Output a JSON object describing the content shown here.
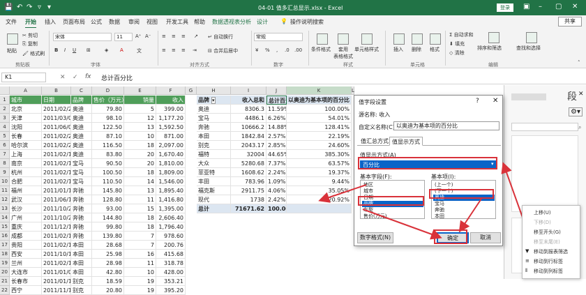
{
  "title": "04-01 值多汇总显示.xlsx - Excel",
  "login_label": "登录",
  "share_label": "共享",
  "window_buttons": [
    "–",
    "▢",
    "✕"
  ],
  "ribbon_tabs": [
    "文件",
    "开始",
    "插入",
    "页面布局",
    "公式",
    "数据",
    "审阅",
    "视图",
    "开发工具",
    "帮助",
    "数据透视表分析",
    "设计",
    "操作说明搜索"
  ],
  "ribbon": {
    "paste": "粘贴",
    "cut": "剪切",
    "copy": "复制",
    "format_painter": "格式刷",
    "font_name": "宋体",
    "font_size": "11",
    "wrap_text": "自动换行",
    "merge_center": "合并后居中",
    "number_format": "常规",
    "cond_format": "条件格式",
    "format_as_table": "套用\n表格格式",
    "cell_styles": "单元格样式",
    "insert": "插入",
    "delete": "删除",
    "format": "格式",
    "autosum": "自动求和",
    "fill": "填充",
    "clear": "清除",
    "sort_filter": "排序和筛选",
    "find_select": "查找和选择",
    "groups": [
      "剪贴板",
      "字体",
      "对齐方式",
      "数字",
      "样式",
      "单元格",
      "编辑"
    ]
  },
  "formula_bar": {
    "name_box": "K1",
    "content": "总计百分比"
  },
  "columns": [
    "A",
    "B",
    "C",
    "D",
    "E",
    "F",
    "G",
    "H",
    "I",
    "J",
    "K",
    "L"
  ],
  "headers": [
    "城市",
    "日期",
    "品牌",
    "售价（万元）",
    "销量",
    "收入"
  ],
  "rows": [
    [
      "北京",
      "2011/02/23",
      "奥迪",
      "79.80",
      "5",
      "399.00"
    ],
    [
      "天津",
      "2011/03/04",
      "奥迪",
      "98.10",
      "12",
      "1,177.20"
    ],
    [
      "沈阳",
      "2011/06/09",
      "奥迪",
      "122.50",
      "13",
      "1,592.50"
    ],
    [
      "长春",
      "2011/02/23",
      "奥迪",
      "87.10",
      "10",
      "871.00"
    ],
    [
      "哈尔滨",
      "2011/02/24",
      "奥迪",
      "116.50",
      "18",
      "2,097.00"
    ],
    [
      "上海",
      "2011/02/10",
      "奥迪",
      "83.80",
      "20",
      "1,670.40"
    ],
    [
      "南京",
      "2011/02/13",
      "宝马",
      "90.50",
      "20",
      "1,810.00"
    ],
    [
      "杭州",
      "2011/02/15",
      "宝马",
      "100.50",
      "18",
      "1,809.00"
    ],
    [
      "合肥",
      "2011/02/12",
      "宝马",
      "110.50",
      "14",
      "1,546.00"
    ],
    [
      "福州",
      "2011/01/13",
      "奔驰",
      "145.80",
      "13",
      "1,895.40"
    ],
    [
      "武汉",
      "2011/06/10",
      "奔驰",
      "128.80",
      "11",
      "1,416.80"
    ],
    [
      "长沙",
      "2011/10/26",
      "奔驰",
      "93.00",
      "15",
      "1,395.00"
    ],
    [
      "广州",
      "2011/10/26",
      "奔驰",
      "144.80",
      "18",
      "2,606.40"
    ],
    [
      "重庆",
      "2011/12/15",
      "奔驰",
      "99.80",
      "18",
      "1,796.40"
    ],
    [
      "成都",
      "2011/02/19",
      "奔驰",
      "139.80",
      "7",
      "978.60"
    ],
    [
      "贵阳",
      "2011/02/19",
      "本田",
      "28.68",
      "7",
      "200.76"
    ],
    [
      "西安",
      "2011/10/10",
      "本田",
      "25.98",
      "16",
      "415.68"
    ],
    [
      "兰州",
      "2011/02/15",
      "本田",
      "28.98",
      "11",
      "318.78"
    ],
    [
      "大连市",
      "2011/01/02",
      "本田",
      "42.80",
      "10",
      "428.00"
    ],
    [
      "长春市",
      "2011/01/13",
      "别克",
      "18.59",
      "19",
      "353.21"
    ],
    [
      "西宁",
      "2011/11/15",
      "别克",
      "20.80",
      "19",
      "395.20"
    ]
  ],
  "pivot": {
    "headers": [
      "品牌",
      "收入总和",
      "总计百分比",
      "以奥迪为基本项的百分比"
    ],
    "rows": [
      [
        "奥迪",
        "8306.3",
        "11.59%",
        "100.00%"
      ],
      [
        "宝马",
        "4486.1",
        "6.26%",
        "54.01%"
      ],
      [
        "奔驰",
        "10666.2",
        "14.88%",
        "128.41%"
      ],
      [
        "本田",
        "1842.84",
        "2.57%",
        "22.19%"
      ],
      [
        "别克",
        "2043.17",
        "2.85%",
        "24.60%"
      ],
      [
        "福特",
        "32004",
        "44.65%",
        "385.30%"
      ],
      [
        "大众",
        "5280.68",
        "7.37%",
        "63.57%"
      ],
      [
        "菲亚特",
        "1608.62",
        "2.24%",
        "19.37%"
      ],
      [
        "丰田",
        "783.96",
        "1.09%",
        "9.44%"
      ],
      [
        "福克斯",
        "2911.75",
        "4.06%",
        "35.05%"
      ],
      [
        "现代",
        "1738",
        "2.42%",
        "20.92%"
      ]
    ],
    "total": [
      "总计",
      "71671.62",
      "100.00%",
      ""
    ]
  },
  "dialog": {
    "title": "值字段设置",
    "help": "?",
    "close": "✕",
    "source_label": "源名称: 收入",
    "custom_name_label": "自定义名称(C):",
    "custom_name": "以奥迪为基本项的百分比",
    "tab_summarize": "值汇总方式",
    "tab_show_as": "值显示方式",
    "show_as_label": "值显示方式(A)",
    "show_as_value": "百分比",
    "base_field_label": "基本字段(F):",
    "base_item_label": "基本项(I):",
    "base_fields": [
      "地区",
      "城市",
      "日期",
      "品牌",
      "车型",
      "售价(万元)"
    ],
    "base_items": [
      "(上一个)",
      "(下一个)",
      "奥迪",
      "宝马",
      "奔驰",
      "本田"
    ],
    "number_format_btn": "数字格式(N)",
    "ok": "确定",
    "cancel": "取消"
  },
  "context_menu": [
    "上移(U)",
    "下移(D)",
    "移至开头(G)",
    "移至末尾(E)",
    "移动到报表筛选",
    "移动到行标签",
    "移动到列标签"
  ],
  "colors": {
    "excel_green": "#217346",
    "red_box": "#d9323a",
    "selection_blue": "#0a64c8"
  }
}
